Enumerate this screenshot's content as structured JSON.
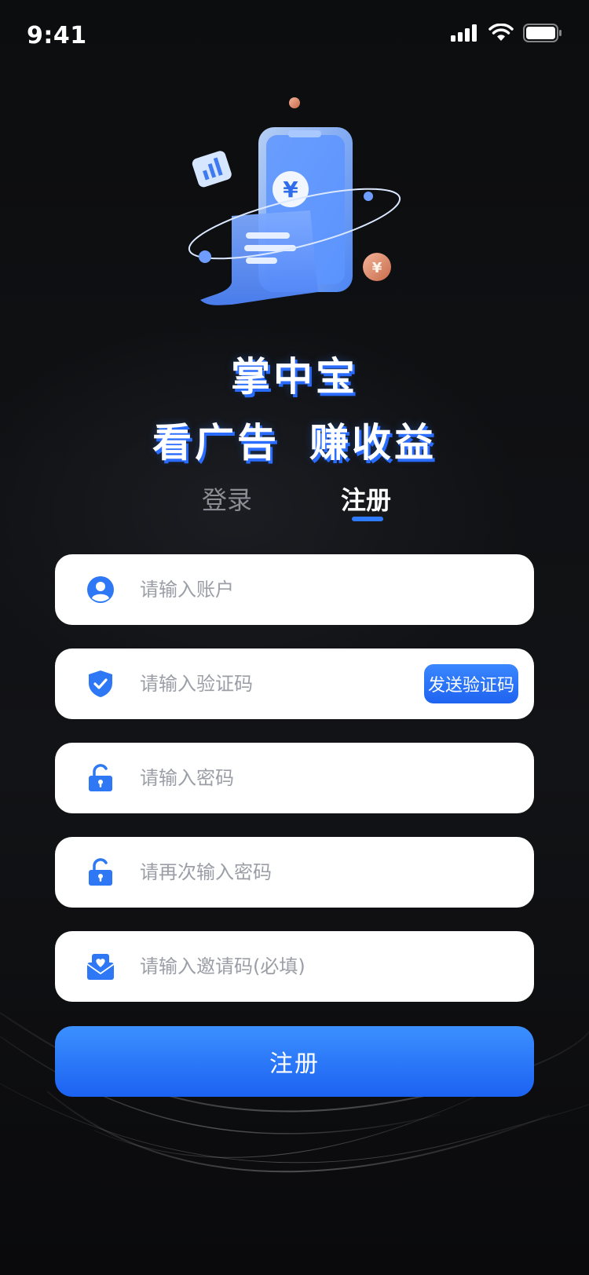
{
  "status_bar": {
    "time": "9:41"
  },
  "hero": {
    "app_name": "掌中宝",
    "slogan_left": "看广告",
    "slogan_right": "赚收益",
    "illustration_symbol": "¥",
    "illustration_icon": "phone-receipt-illustration"
  },
  "tabs": [
    {
      "label": "登录",
      "active": false
    },
    {
      "label": "注册",
      "active": true
    }
  ],
  "form": {
    "account": {
      "placeholder": "请输入账户",
      "icon": "user-icon"
    },
    "code": {
      "placeholder": "请输入验证码",
      "icon": "shield-check-icon",
      "send_label": "发送验证码"
    },
    "password": {
      "placeholder": "请输入密码",
      "icon": "lock-icon"
    },
    "password_confirm": {
      "placeholder": "请再次输入密码",
      "icon": "lock-icon"
    },
    "invite": {
      "placeholder": "请输入邀请码(必填)",
      "icon": "invite-mail-icon"
    },
    "submit_label": "注册"
  },
  "colors": {
    "background": "#0d0e10",
    "accent": "#2f7bff",
    "field_bg": "#ffffff",
    "placeholder": "#9b9ea6",
    "icon_blue": "#2f78f5"
  }
}
